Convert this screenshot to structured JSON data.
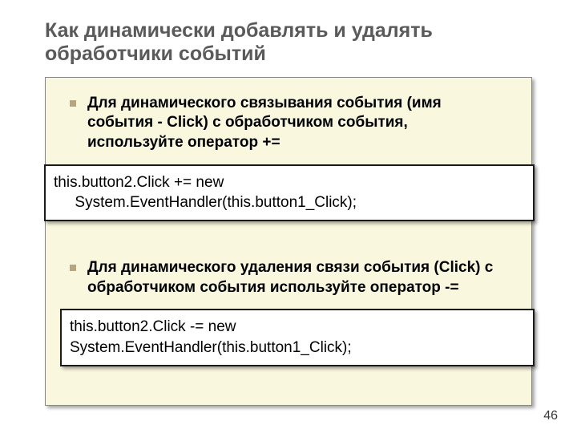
{
  "slide": {
    "title": "Как динамически добавлять и удалять обработчики событий",
    "bullets": [
      "Для динамического связывания события (имя события - Click) с обработчиком события, используйте оператор +=",
      "Для динамического удаления связи события (Click) с обработчиком события используйте оператор -="
    ],
    "code": [
      "this.button2.Click += new\n     System.EventHandler(this.button1_Click);",
      "this.button2.Click -= new\nSystem.EventHandler(this.button1_Click);"
    ],
    "page_number": "46"
  }
}
